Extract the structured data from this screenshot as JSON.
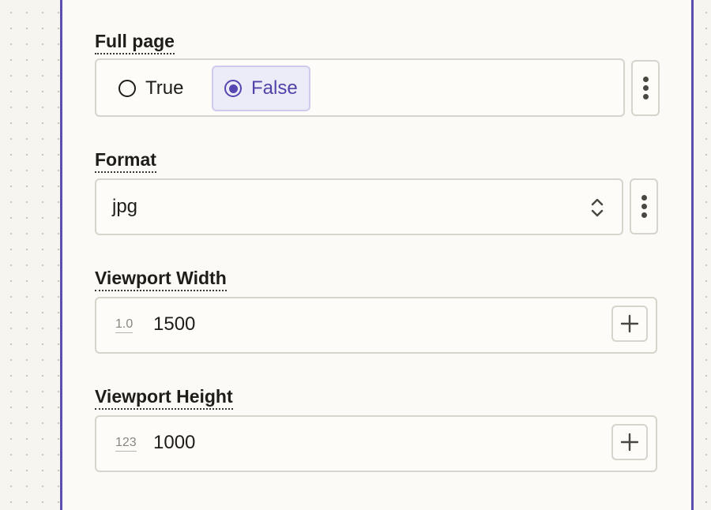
{
  "full_page": {
    "label": "Full page",
    "options": [
      {
        "label": "True",
        "selected": false
      },
      {
        "label": "False",
        "selected": true
      }
    ]
  },
  "format": {
    "label": "Format",
    "value": "jpg"
  },
  "viewport_width": {
    "label": "Viewport Width",
    "type_icon": "1.0",
    "value": "1500"
  },
  "viewport_height": {
    "label": "Viewport Height",
    "type_icon": "123",
    "value": "1000"
  },
  "colors": {
    "accent": "#5d4fb0",
    "selected_bg": "#ecebf8",
    "panel_bg": "#fbfaf6",
    "border": "#d7d4cc"
  },
  "icons": [
    "radio-unchecked-icon",
    "radio-checked-icon",
    "more-vertical-icon",
    "chevron-up-down-icon",
    "plus-icon",
    "decimal-type-icon",
    "integer-type-icon"
  ]
}
